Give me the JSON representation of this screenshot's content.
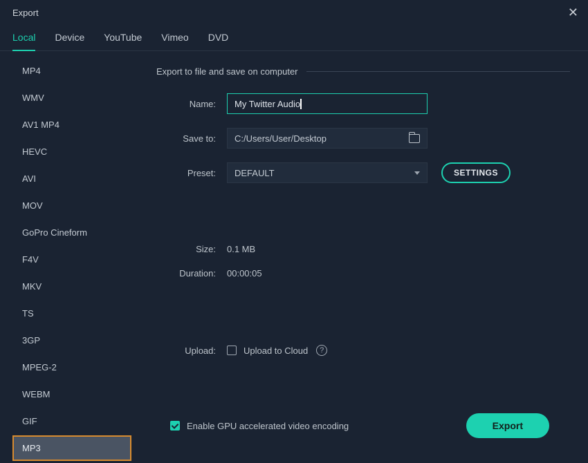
{
  "window": {
    "title": "Export"
  },
  "tabs": [
    {
      "label": "Local",
      "active": true
    },
    {
      "label": "Device",
      "active": false
    },
    {
      "label": "YouTube",
      "active": false
    },
    {
      "label": "Vimeo",
      "active": false
    },
    {
      "label": "DVD",
      "active": false
    }
  ],
  "formats": [
    {
      "label": "MP4",
      "selected": false
    },
    {
      "label": "WMV",
      "selected": false
    },
    {
      "label": "AV1 MP4",
      "selected": false
    },
    {
      "label": "HEVC",
      "selected": false
    },
    {
      "label": "AVI",
      "selected": false
    },
    {
      "label": "MOV",
      "selected": false
    },
    {
      "label": "GoPro Cineform",
      "selected": false
    },
    {
      "label": "F4V",
      "selected": false
    },
    {
      "label": "MKV",
      "selected": false
    },
    {
      "label": "TS",
      "selected": false
    },
    {
      "label": "3GP",
      "selected": false
    },
    {
      "label": "MPEG-2",
      "selected": false
    },
    {
      "label": "WEBM",
      "selected": false
    },
    {
      "label": "GIF",
      "selected": false
    },
    {
      "label": "MP3",
      "selected": true
    }
  ],
  "main": {
    "section_title": "Export to file and save on computer",
    "name_label": "Name:",
    "name_value": "My Twitter Audio",
    "saveto_label": "Save to:",
    "saveto_value": "C:/Users/User/Desktop",
    "preset_label": "Preset:",
    "preset_value": "DEFAULT",
    "settings_button": "SETTINGS",
    "size_label": "Size:",
    "size_value": "0.1 MB",
    "duration_label": "Duration:",
    "duration_value": "00:00:05",
    "upload_label": "Upload:",
    "upload_checkbox_label": "Upload to Cloud",
    "upload_checked": false
  },
  "footer": {
    "gpu_label": "Enable GPU accelerated video encoding",
    "gpu_checked": true,
    "export_button": "Export"
  }
}
